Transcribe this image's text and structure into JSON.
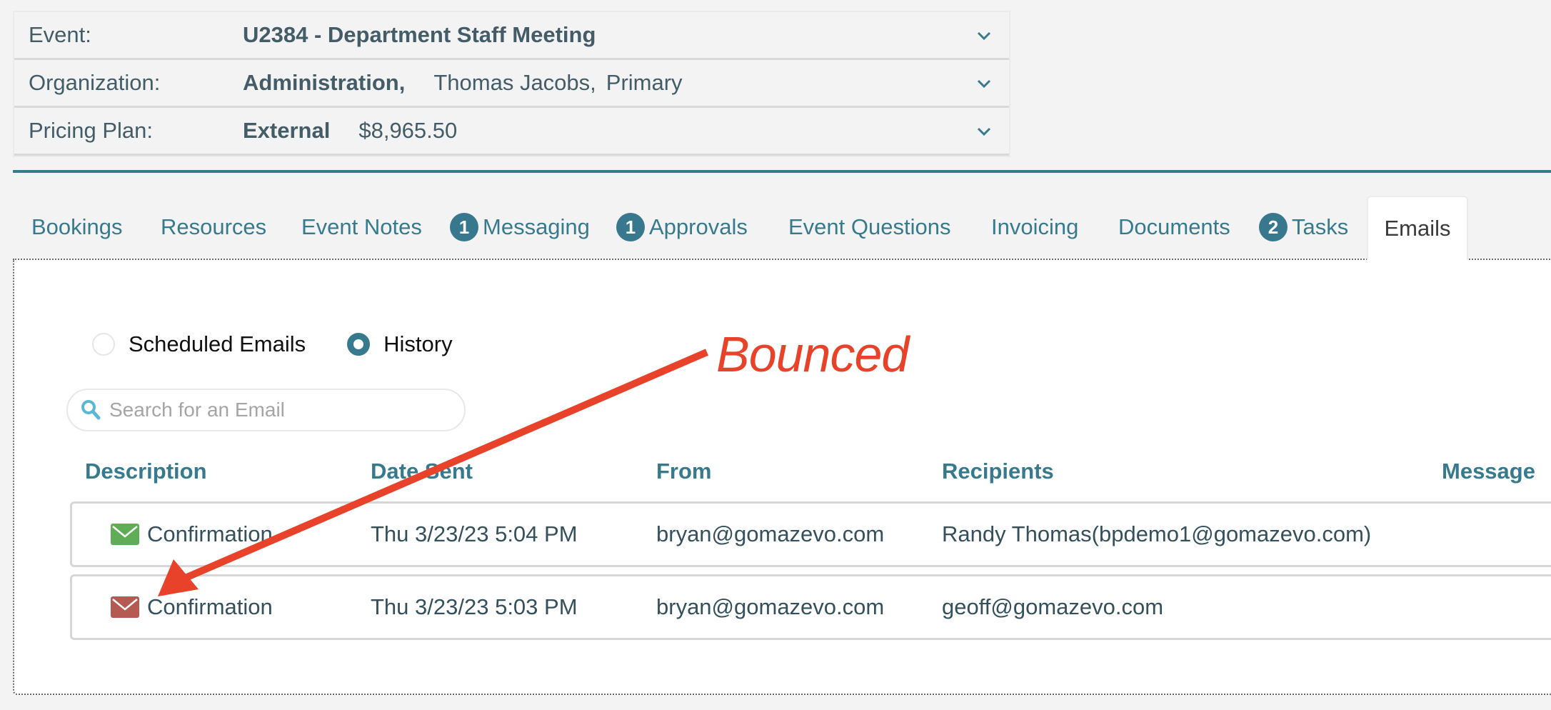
{
  "info_panel": {
    "rows": [
      {
        "label": "Event:",
        "values": [
          {
            "text": "U2384 - Department Staff Meeting",
            "bold": true
          }
        ]
      },
      {
        "label": "Organization:",
        "values": [
          {
            "text": "Administration,",
            "bold": true
          },
          {
            "text": "Thomas Jacobs,",
            "bold": false
          },
          {
            "text": "Primary",
            "bold": false
          }
        ]
      },
      {
        "label": "Pricing Plan:",
        "values": [
          {
            "text": "External",
            "bold": true
          },
          {
            "text": "$8,965.50",
            "bold": false
          }
        ]
      }
    ],
    "chevron_icon": "chevron-down-icon"
  },
  "tabs": [
    {
      "label": "Bookings",
      "badge": null,
      "active": false
    },
    {
      "label": "Resources",
      "badge": null,
      "active": false
    },
    {
      "label": "Event Notes",
      "badge": null,
      "active": false
    },
    {
      "label": "Messaging",
      "badge": "1",
      "active": false
    },
    {
      "label": "Approvals",
      "badge": "1",
      "active": false
    },
    {
      "label": "Event Questions",
      "badge": null,
      "active": false
    },
    {
      "label": "Invoicing",
      "badge": null,
      "active": false
    },
    {
      "label": "Documents",
      "badge": null,
      "active": false
    },
    {
      "label": "Tasks",
      "badge": "2",
      "active": false
    },
    {
      "label": "Emails",
      "badge": null,
      "active": true
    }
  ],
  "emails": {
    "view_options": [
      {
        "label": "Scheduled Emails",
        "checked": false
      },
      {
        "label": "History",
        "checked": true
      }
    ],
    "search": {
      "placeholder": "Search for an Email",
      "value": "",
      "icon": "search-icon"
    },
    "columns": [
      "Description",
      "Date Sent",
      "From",
      "Recipients",
      "Message"
    ],
    "rows": [
      {
        "status": "delivered",
        "status_color": "#5fad56",
        "description": "Confirmation",
        "date_sent": "Thu 3/23/23 5:04 PM",
        "from": "bryan@gomazevo.com",
        "recipients": "Randy Thomas(bpdemo1@gomazevo.com)",
        "message": ""
      },
      {
        "status": "bounced",
        "status_color": "#b55a52",
        "description": "Confirmation",
        "date_sent": "Thu 3/23/23 5:03 PM",
        "from": "bryan@gomazevo.com",
        "recipients": "geoff@gomazevo.com",
        "message": ""
      }
    ]
  },
  "annotation": {
    "text": "Bounced",
    "color": "#e8432a",
    "points_to": "bounced email status icon (row 2)"
  },
  "colors": {
    "accent": "#377a8e",
    "background": "#f3f3f3"
  }
}
